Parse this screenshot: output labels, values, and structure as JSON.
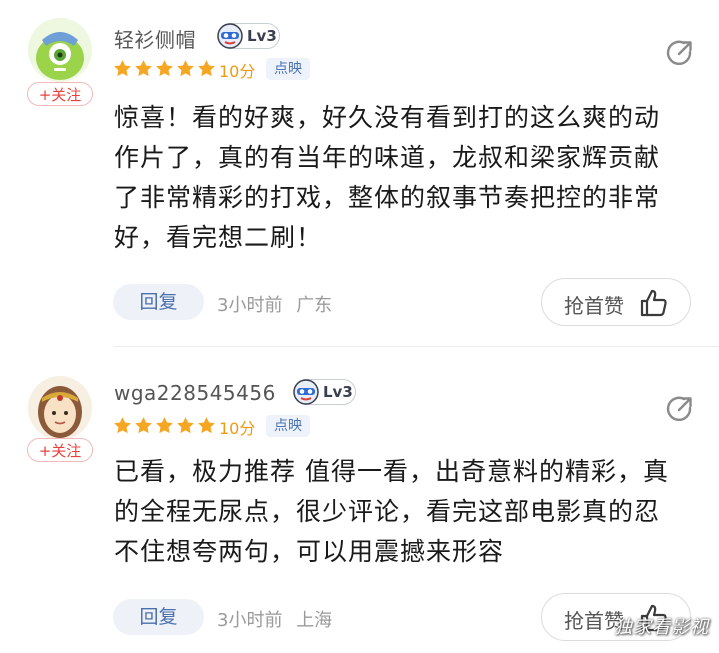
{
  "comments": [
    {
      "username": "轻衫侧帽",
      "level": "Lv3",
      "follow_label": "+关注",
      "rating_stars": 5,
      "score": "10分",
      "source": "点映",
      "text": "惊喜！看的好爽，好久没有看到打的这么爽的动作片了，真的有当年的味道，龙叔和梁家辉贡献了非常精彩的打戏，整体的叙事节奏把控的非常好，看完想二刷！",
      "reply_label": "回复",
      "time": "3小时前",
      "location": "广东",
      "like_label": "抢首赞"
    },
    {
      "username": "wga228545456",
      "level": "Lv3",
      "follow_label": "+关注",
      "rating_stars": 5,
      "score": "10分",
      "source": "点映",
      "text": "已看，极力推荐 值得一看，出奇意料的精彩，真的全程无尿点，很少评论，看完这部电影真的忍不住想夸两句，可以用震撼来形容",
      "reply_label": "回复",
      "time": "3小时前",
      "location": "上海",
      "like_label": "抢首赞"
    }
  ],
  "watermark": "独家看影视",
  "colors": {
    "star": "#f5a623",
    "score": "#f09a14",
    "follow": "#e8413d",
    "reply_bg": "#eef1f7",
    "reply_text": "#4a70ae"
  },
  "icons": {
    "share": "share-icon",
    "thumb": "thumbs-up-icon",
    "star": "star-icon"
  }
}
